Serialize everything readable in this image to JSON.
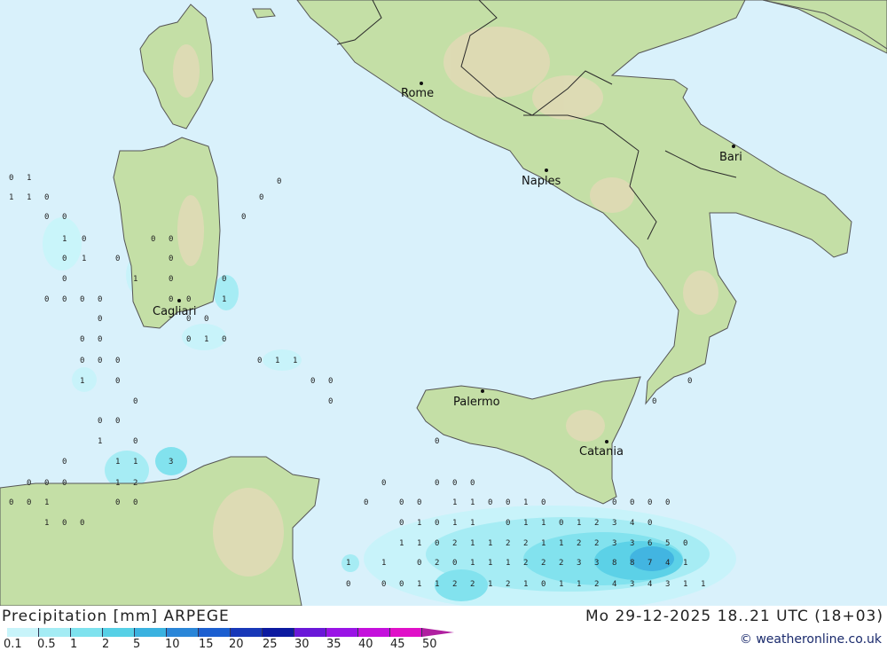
{
  "title": "Precipitation [mm] ARPEGE",
  "datetime": "Mo 29-12-2025 18..21 UTC (18+03)",
  "credit": "© weatheronline.co.uk",
  "legend": {
    "ticks": [
      "0.1",
      "0.5",
      "1",
      "2",
      "5",
      "10",
      "15",
      "20",
      "25",
      "30",
      "35",
      "40",
      "45",
      "50"
    ],
    "colors": [
      "#c8f4fa",
      "#a4ecf4",
      "#7ee2ee",
      "#56d0e6",
      "#3ab2e0",
      "#2a86d8",
      "#1c5fd0",
      "#1838b8",
      "#0c1aa0",
      "#6a18d8",
      "#9a14e6",
      "#c410dc",
      "#e010c8",
      "#b020a0"
    ]
  },
  "cities": [
    {
      "name": "Rome",
      "icon": "city-dot-icon"
    },
    {
      "name": "Naples",
      "icon": "city-dot-icon"
    },
    {
      "name": "Bari",
      "icon": "city-dot-icon"
    },
    {
      "name": "Cagliari",
      "icon": "city-dot-icon"
    },
    {
      "name": "Palermo",
      "icon": "city-dot-icon"
    },
    {
      "name": "Catania",
      "icon": "city-dot-icon"
    }
  ],
  "colors": {
    "sea": "#d9f1fb",
    "land": "#c4dfa6",
    "border": "#2a2a2a",
    "coast": "#555555"
  }
}
